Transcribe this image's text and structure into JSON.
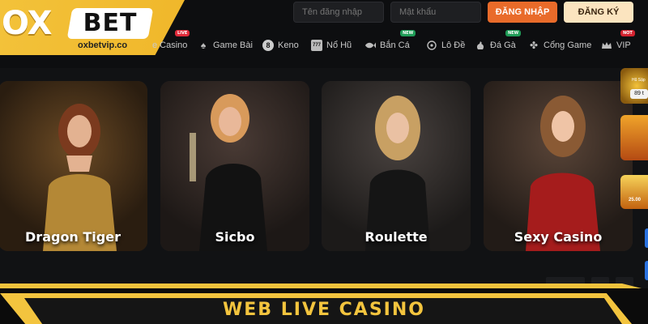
{
  "brand": {
    "ox": "OX",
    "bet": "BET",
    "url": "oxbetvip.co",
    "accent": "#f3c23a"
  },
  "auth": {
    "username_placeholder": "Tên đăng nhập",
    "password_placeholder": "Mật khẩu",
    "login_label": "ĐĂNG NHẬP",
    "register_label": "ĐĂNG KÝ"
  },
  "nav": {
    "items": [
      {
        "label": "e Casino",
        "icon": "live-casino-icon",
        "badge": "LIVE"
      },
      {
        "label": "Game Bài",
        "icon": "spade-icon",
        "badge": ""
      },
      {
        "label": "Keno",
        "icon": "keno-ball-icon",
        "glyph": "8",
        "badge": ""
      },
      {
        "label": "Nổ Hũ",
        "icon": "slot-777-icon",
        "glyph": "777",
        "badge": ""
      },
      {
        "label": "Bắn Cá",
        "icon": "fish-icon",
        "badge": "NEW"
      },
      {
        "label": "Lô Đề",
        "icon": "lottery-icon",
        "badge": ""
      },
      {
        "label": "Đá Gà",
        "icon": "rooster-icon",
        "badge": "NEW"
      },
      {
        "label": "Cổng Game",
        "icon": "game-portal-icon",
        "badge": ""
      },
      {
        "label": "VIP",
        "icon": "crown-icon",
        "badge": "NOT"
      }
    ]
  },
  "games": [
    {
      "title": "Dragon Tiger",
      "color": "#3b2a17"
    },
    {
      "title": "Sicbo",
      "color": "#2b2624"
    },
    {
      "title": "Roulette",
      "color": "#2d2a28"
    },
    {
      "title": "Sexy Casino",
      "color": "#3a2523"
    }
  ],
  "side_promo": {
    "line1": "Hũ Sập",
    "line2": "89 t",
    "line3": "25.00"
  },
  "banner": {
    "text": "WEB LIVE CASINO"
  }
}
